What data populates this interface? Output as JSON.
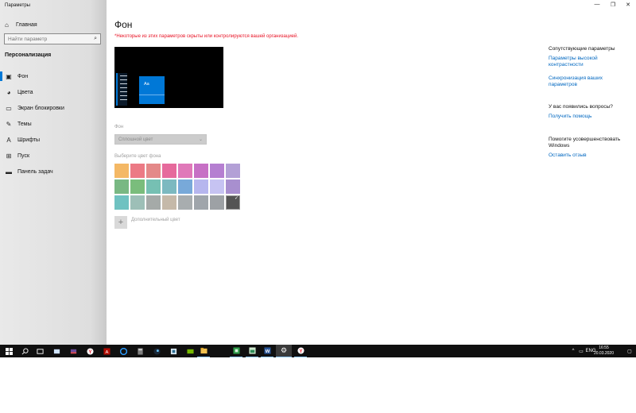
{
  "window": {
    "title": "Параметры",
    "controls": {
      "minimize": "—",
      "maximize": "❐",
      "close": "✕"
    }
  },
  "sidebar": {
    "home_label": "Главная",
    "search_placeholder": "Найти параметр",
    "section_title": "Персонализация",
    "items": [
      {
        "label": "Фон",
        "icon": "picture-icon",
        "active": true
      },
      {
        "label": "Цвета",
        "icon": "palette-icon",
        "active": false
      },
      {
        "label": "Экран блокировки",
        "icon": "monitor-icon",
        "active": false
      },
      {
        "label": "Темы",
        "icon": "brush-icon",
        "active": false
      },
      {
        "label": "Шрифты",
        "icon": "font-icon",
        "active": false
      },
      {
        "label": "Пуск",
        "icon": "start-icon",
        "active": false
      },
      {
        "label": "Панель задач",
        "icon": "taskbar-icon",
        "active": false
      }
    ]
  },
  "main": {
    "title": "Фон",
    "org_warning": "*Некоторые из этих параметров скрыты или контролируются вашей организацией.",
    "preview_tile_text": "Aa",
    "background_label": "Фон",
    "background_value": "Сплошной цвет",
    "colors_label": "Выберите цвет фона",
    "swatches": [
      "#f4b865",
      "#ec7a85",
      "#e48989",
      "#e66a9c",
      "#e079b9",
      "#c770c5",
      "#b57fd1",
      "#b3a0d6",
      "#79b883",
      "#7abd7c",
      "#76c0b3",
      "#7cb9c0",
      "#78a9d9",
      "#b6b6ee",
      "#c6c3f2",
      "#a88fcf",
      "#6fc2c1",
      "#9dbfb7",
      "#a5aaa8",
      "#c5b9a9",
      "#a8adaf",
      "#9fa5ab",
      "#9da1a5",
      "#545454"
    ],
    "selected_swatch": 23,
    "add_color_label": "Дополнительный цвет"
  },
  "related": {
    "title": "Сопутствующие параметры",
    "links": [
      "Параметры высокой контрастности",
      "Синхронизация ваших параметров"
    ],
    "questions_title": "У вас появились вопросы?",
    "help_link": "Получить помощь",
    "improve_title": "Помогите усовершенствовать Windows",
    "feedback_link": "Оставить отзыв"
  },
  "taskbar": {
    "language": "ENG",
    "time": "16:55",
    "date": "20.03.2020",
    "apps": [
      "windows-start-icon",
      "search-icon",
      "task-view-icon",
      "mail-icon",
      "media-icon",
      "yandex-browser-icon",
      "acrobat-icon",
      "edge-icon",
      "calculator-icon",
      "steam-icon",
      "vpn-icon",
      "nvidia-icon",
      "file-explorer-icon",
      "green-app-icon",
      "image-app-icon",
      "word-icon",
      "settings-icon",
      "yandex-icon"
    ]
  }
}
